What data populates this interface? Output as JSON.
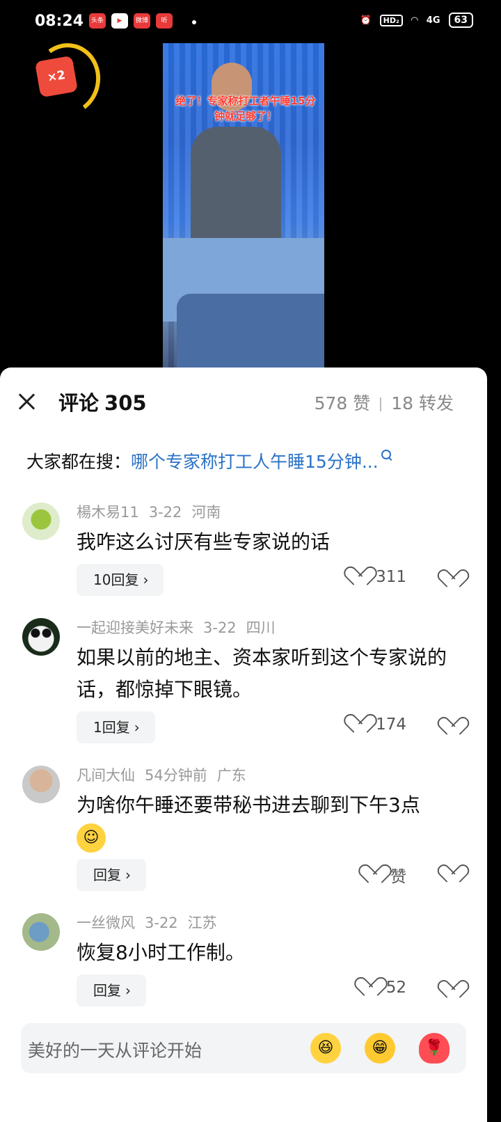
{
  "status_bar": {
    "time": "08:24",
    "apps": [
      "头条",
      "▶",
      "微博",
      "听"
    ],
    "network": "HD₂",
    "signal": "4G",
    "battery": "63"
  },
  "reward": {
    "label": "×2"
  },
  "video": {
    "caption": "绝了！专家称打工者午睡15分钟就足够了！"
  },
  "panel": {
    "title": "评论",
    "count": "305",
    "likes": "578 赞",
    "shares": "18 转发"
  },
  "search": {
    "label": "大家都在搜：",
    "query": "哪个专家称打工人午睡15分钟..."
  },
  "comments": [
    {
      "user": "楊木易11",
      "date": "3-22",
      "location": "河南",
      "text": "我咋这么讨厌有些专家说的话",
      "reply": "10回复",
      "likes": "311"
    },
    {
      "user": "一起迎接美好未来",
      "date": "3-22",
      "location": "四川",
      "text": "如果以前的地主、资本家听到这个专家说的话，都惊掉下眼镜。",
      "reply": "1回复",
      "likes": "174"
    },
    {
      "user": "凡间大仙",
      "date": "54分钟前",
      "location": "广东",
      "text": "为啥你午睡还要带秘书进去聊到下午3点",
      "reply": "回复",
      "likes": "赞"
    },
    {
      "user": "一丝微风",
      "date": "3-22",
      "location": "江苏",
      "text": "恢复8小时工作制。",
      "reply": "回复",
      "likes": "52"
    }
  ],
  "input": {
    "placeholder": "美好的一天从评论开始"
  },
  "chevron": "›"
}
